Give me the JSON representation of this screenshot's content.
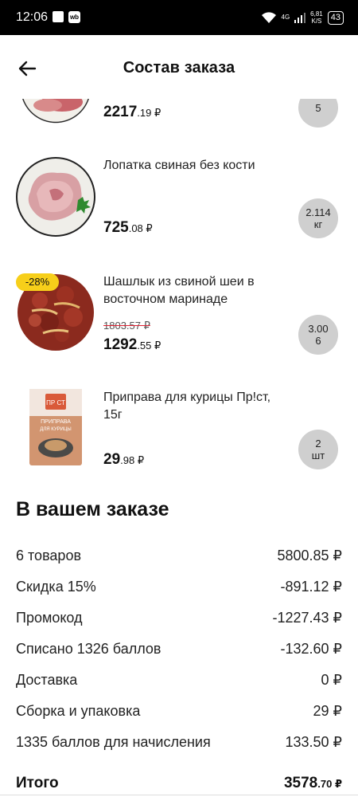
{
  "status_bar": {
    "time": "12:06",
    "network": "4G",
    "speed_value": "6,81",
    "speed_unit": "K/S",
    "battery": "43",
    "wb_label": "wb"
  },
  "header": {
    "title": "Состав заказа"
  },
  "items": [
    {
      "name": "",
      "price_rub": "2217",
      "price_kop": ".19 ₽",
      "qty_top": "",
      "qty_bottom": "5"
    },
    {
      "name": "Лопатка свиная без кости",
      "price_rub": "725",
      "price_kop": ".08 ₽",
      "qty_top": "2.114",
      "qty_bottom": "кг"
    },
    {
      "name": "Шашлык из свиной шеи в восточном маринаде",
      "discount": "-28%",
      "old_price": "1803.57 ₽",
      "price_rub": "1292",
      "price_kop": ".55 ₽",
      "qty_top": "3.00",
      "qty_bottom": "6"
    },
    {
      "name": "Приправа для курицы Пр!ст, 15г",
      "price_rub": "29",
      "price_kop": ".98 ₽",
      "qty_top": "2",
      "qty_bottom": "шт"
    }
  ],
  "package_text": {
    "brand": "ПР СТ",
    "line1": "ПРИПРАВА",
    "line2": "ДЛЯ КУРИЦЫ"
  },
  "summary": {
    "title": "В вашем заказе",
    "rows": [
      {
        "label": "6 товаров",
        "value": "5800.85 ₽"
      },
      {
        "label": "Скидка 15%",
        "value": "-891.12 ₽"
      },
      {
        "label": "Промокод",
        "value": "-1227.43 ₽"
      },
      {
        "label": "Списано 1326 баллов",
        "value": "-132.60 ₽"
      },
      {
        "label": "Доставка",
        "value": "0 ₽"
      },
      {
        "label": "Сборка и упаковка",
        "value": "29 ₽"
      },
      {
        "label": "1335 баллов для начисления",
        "value": "133.50 ₽"
      }
    ],
    "total_label": "Итого",
    "total_rub": "3578",
    "total_kop": ".70 ₽"
  },
  "colors": {
    "badge": "#f7cf1a",
    "qty_bg": "#cfcfcf"
  }
}
